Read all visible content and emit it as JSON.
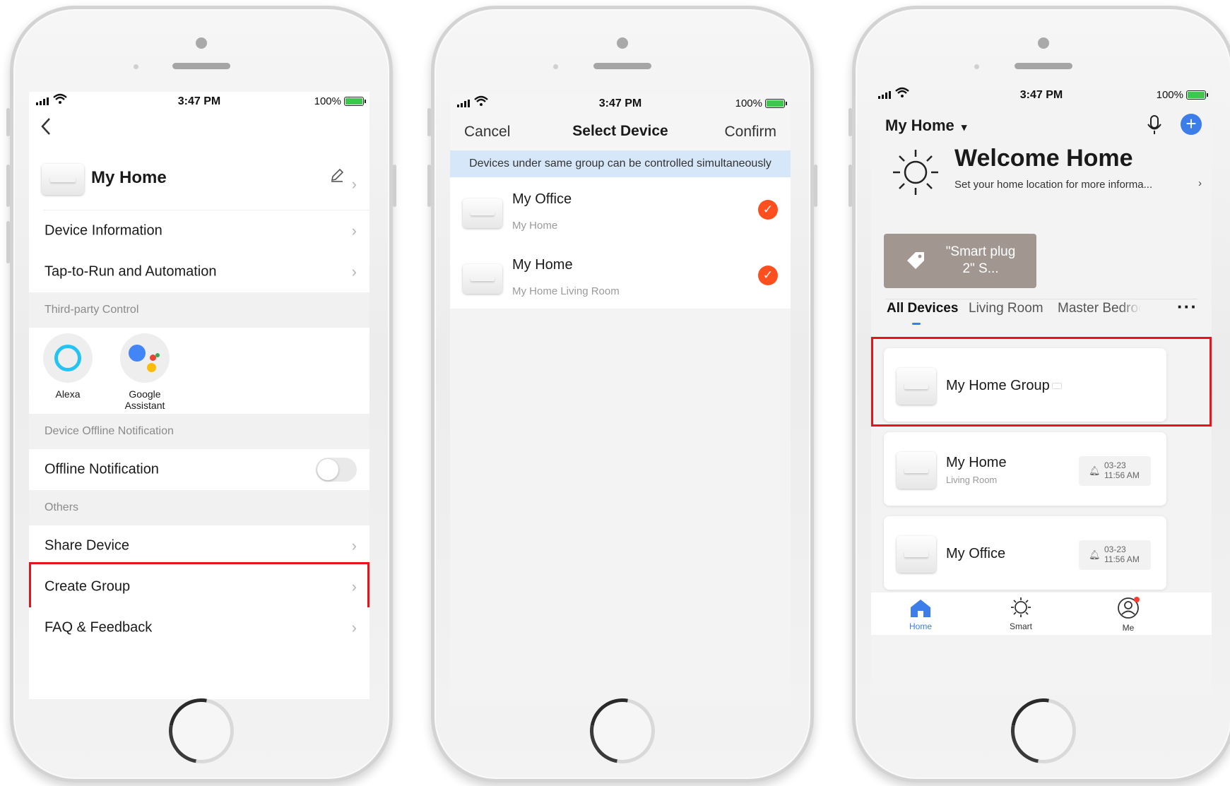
{
  "status": {
    "time": "3:47 PM",
    "battery": "100%"
  },
  "settings_screen": {
    "device_name": "My Home",
    "rows": {
      "device_information": "Device Information",
      "tap_to_run": "Tap-to-Run and Automation",
      "share_device": "Share Device",
      "create_group": "Create Group",
      "faq": "FAQ & Feedback",
      "offline_notification": "Offline Notification"
    },
    "sections": {
      "third_party": "Third-party Control",
      "offline": "Device Offline Notification",
      "others": "Others"
    },
    "third_party": [
      {
        "label": "Alexa",
        "icon": "alexa-icon"
      },
      {
        "label": "Google\nAssistant",
        "icon": "google-assistant-icon"
      }
    ],
    "offline_toggle": false
  },
  "select_screen": {
    "cancel": "Cancel",
    "title": "Select Device",
    "confirm": "Confirm",
    "banner": "Devices under same group can be controlled simultaneously",
    "devices": [
      {
        "name": "My Office",
        "sub": "My Home",
        "checked": true
      },
      {
        "name": "My Home",
        "sub": "My Home Living Room",
        "checked": true
      }
    ]
  },
  "home_screen": {
    "home_selector": "My Home",
    "welcome_title": "Welcome Home",
    "welcome_sub": "Set your home location for more informa...",
    "scene_card": "\"Smart plug 2\" S...",
    "tabs": [
      "All Devices",
      "Living Room",
      "Master Bedroo"
    ],
    "active_tab": "All Devices",
    "devices": [
      {
        "name": "My Home Group",
        "sub": "",
        "date": "",
        "time": ""
      },
      {
        "name": "My Home",
        "sub": "Living Room",
        "date": "03-23",
        "time": "11:56 AM"
      },
      {
        "name": "My Office",
        "sub": "",
        "date": "03-23",
        "time": "11:56 AM"
      }
    ],
    "nav": [
      {
        "label": "Home",
        "icon": "home-icon",
        "active": true
      },
      {
        "label": "Smart",
        "icon": "sun-icon",
        "active": false
      },
      {
        "label": "Me",
        "icon": "profile-icon",
        "active": false
      }
    ],
    "accent": "#3c7de9"
  },
  "colors": {
    "highlight": "#e8141c",
    "check": "#ff4f1f",
    "banner": "#d6e7f9"
  }
}
